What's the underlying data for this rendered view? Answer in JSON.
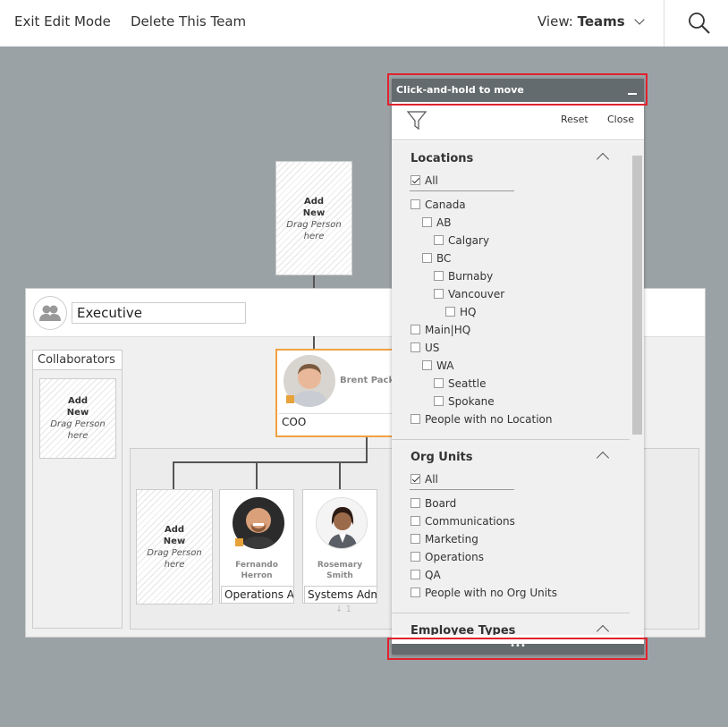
{
  "topbar": {
    "exit_edit": "Exit Edit Mode",
    "delete_team": "Delete This Team",
    "view_prefix": "View:",
    "view_value": "Teams"
  },
  "add_new": {
    "title_line1": "Add",
    "title_line2": "New",
    "sub_line1": "Drag Person",
    "sub_line2": "here"
  },
  "team": {
    "name": "Executive",
    "collaborators_label": "Collaborators"
  },
  "manager": {
    "name": "Brent Pack",
    "role": "COO"
  },
  "reports": [
    {
      "first": "Fernando",
      "last": "Herron",
      "role": "Operations Ad"
    },
    {
      "first": "Rosemary",
      "last": "Smith",
      "role": "Systems Adm"
    }
  ],
  "more_count": "1",
  "filter": {
    "title": "Click-and-hold to move",
    "reset": "Reset",
    "close": "Close",
    "more": "•••",
    "locations": {
      "title": "Locations",
      "all": "All",
      "items": [
        "Canada",
        "AB",
        "Calgary",
        "BC",
        "Burnaby",
        "Vancouver",
        "HQ",
        "Main|HQ",
        "US",
        "WA",
        "Seattle",
        "Spokane",
        "People with no Location"
      ]
    },
    "org_units": {
      "title": "Org Units",
      "all": "All",
      "items": [
        "Board",
        "Communications",
        "Marketing",
        "Operations",
        "QA",
        "People with no Org Units"
      ]
    },
    "employee_types": {
      "title": "Employee Types"
    }
  },
  "colors": {
    "accent_orange": "#e8a23a",
    "highlight_red": "#e0222e",
    "title_bar": "#636b6e",
    "canvas": "#9ba2a5"
  }
}
